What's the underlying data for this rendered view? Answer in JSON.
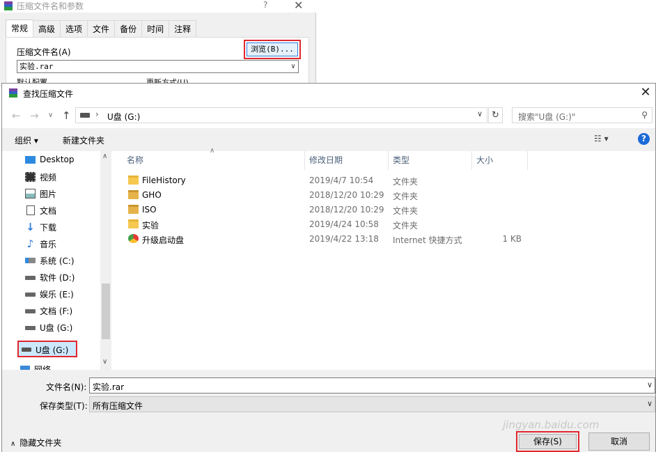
{
  "background_dialog": {
    "title": "压缩文件名和参数",
    "help": "?",
    "close": "✕",
    "tabs": [
      "常规",
      "高级",
      "选项",
      "文件",
      "备份",
      "时间",
      "注释"
    ],
    "archive_name_label": "压缩文件名(A)",
    "browse_button": "浏览(B)...",
    "archive_name_value": "实验.rar",
    "default_profile_label": "默认配置",
    "update_mode_label": "更新方式(U)"
  },
  "dialog": {
    "title": "查找压缩文件",
    "close": "✕",
    "nav": {
      "back": "←",
      "forward": "→",
      "recent": "∨",
      "up": "↑"
    },
    "address": {
      "separator": "›",
      "path": "U盘 (G:)"
    },
    "search_placeholder": "搜索\"U盘 (G:)\"",
    "toolbar": {
      "organize": "组织 ▾",
      "new_folder": "新建文件夹",
      "view": "☷ ▾",
      "help": "?"
    },
    "sidebar": {
      "items": [
        {
          "label": "Desktop",
          "icon": "desktop-icon"
        },
        {
          "label": "视频",
          "icon": "video-icon"
        },
        {
          "label": "图片",
          "icon": "pictures-icon"
        },
        {
          "label": "文档",
          "icon": "documents-icon"
        },
        {
          "label": "下载",
          "icon": "download-icon"
        },
        {
          "label": "音乐",
          "icon": "music-icon"
        },
        {
          "label": "系统 (C:)",
          "icon": "system-drive-icon"
        },
        {
          "label": "软件 (D:)",
          "icon": "drive-icon"
        },
        {
          "label": "娱乐 (E:)",
          "icon": "drive-icon"
        },
        {
          "label": "文档 (F:)",
          "icon": "drive-icon"
        },
        {
          "label": "U盘 (G:)",
          "icon": "usb-drive-icon"
        }
      ],
      "selected": "U盘 (G:)",
      "network": "网络"
    },
    "columns": [
      "名称",
      "修改日期",
      "类型",
      "大小"
    ],
    "files": [
      {
        "name": "FileHistory",
        "date": "2019/4/7 10:54",
        "type": "文件夹",
        "size": "",
        "icon": "folder-icon"
      },
      {
        "name": "GHO",
        "date": "2018/12/20 10:29",
        "type": "文件夹",
        "size": "",
        "icon": "locked-folder-icon"
      },
      {
        "name": "ISO",
        "date": "2018/12/20 10:29",
        "type": "文件夹",
        "size": "",
        "icon": "locked-folder-icon"
      },
      {
        "name": "实验",
        "date": "2019/4/24 10:58",
        "type": "文件夹",
        "size": "",
        "icon": "folder-icon"
      },
      {
        "name": "升级启动盘",
        "date": "2019/4/22 13:18",
        "type": "Internet 快捷方式",
        "size": "1 KB",
        "icon": "shortcut-icon"
      }
    ],
    "filename_label": "文件名(N):",
    "filename_value": "实验.rar",
    "filetype_label": "保存类型(T):",
    "filetype_value": "所有压缩文件",
    "hide_folders": "隐藏文件夹",
    "save_button": "保存(S)",
    "cancel_button": "取消",
    "watermark": "jingyan.baidu.com"
  }
}
